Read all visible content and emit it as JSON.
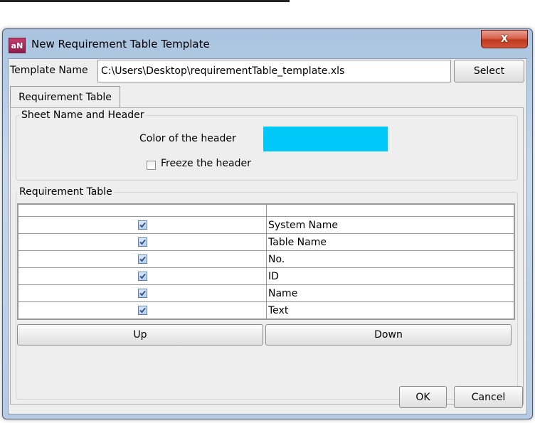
{
  "window": {
    "title": "New Requirement Table Template",
    "app_icon": "aN",
    "close_glyph": "X"
  },
  "template": {
    "label": "Template Name",
    "value": "C:\\Users\\Desktop\\requirementTable_template.xls",
    "select_label": "Select"
  },
  "tabs": [
    {
      "label": "Requirement Table",
      "active": true
    }
  ],
  "sheet_group": {
    "title": "Sheet Name and Header",
    "color_label": "Color of the header",
    "header_color": "#00c8f8",
    "freeze_label": "Freeze the header",
    "freeze_checked": false
  },
  "req_group": {
    "title": "Requirement Table",
    "rows": [
      {
        "checked": true,
        "name": "System Name"
      },
      {
        "checked": true,
        "name": "Table Name"
      },
      {
        "checked": true,
        "name": "No."
      },
      {
        "checked": true,
        "name": "ID"
      },
      {
        "checked": true,
        "name": "Name"
      },
      {
        "checked": true,
        "name": "Text"
      }
    ],
    "up_label": "Up",
    "down_label": "Down"
  },
  "footer": {
    "ok_label": "OK",
    "cancel_label": "Cancel"
  }
}
